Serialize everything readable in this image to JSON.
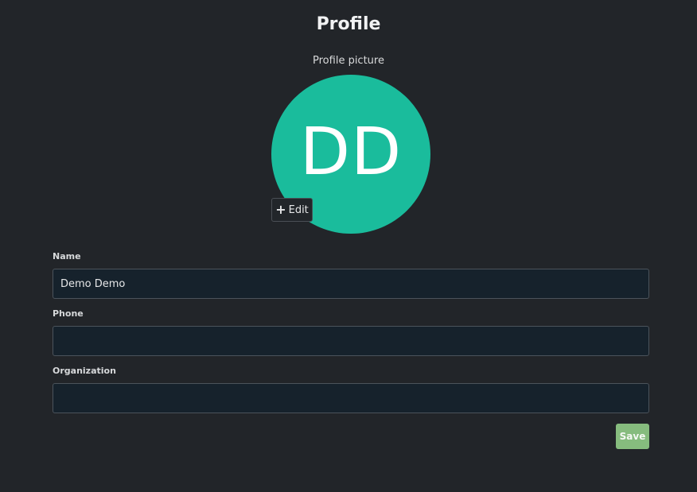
{
  "page": {
    "title": "Profile"
  },
  "profile_picture": {
    "label": "Profile picture",
    "initials": "DD",
    "avatar_color": "#1abc9c",
    "edit_icon": "plus-icon",
    "edit_label": "Edit"
  },
  "form": {
    "name": {
      "label": "Name",
      "value": "Demo Demo",
      "placeholder": ""
    },
    "phone": {
      "label": "Phone",
      "value": "",
      "placeholder": ""
    },
    "organization": {
      "label": "Organization",
      "value": "",
      "placeholder": ""
    },
    "save_label": "Save",
    "save_color": "#86bc7e"
  }
}
